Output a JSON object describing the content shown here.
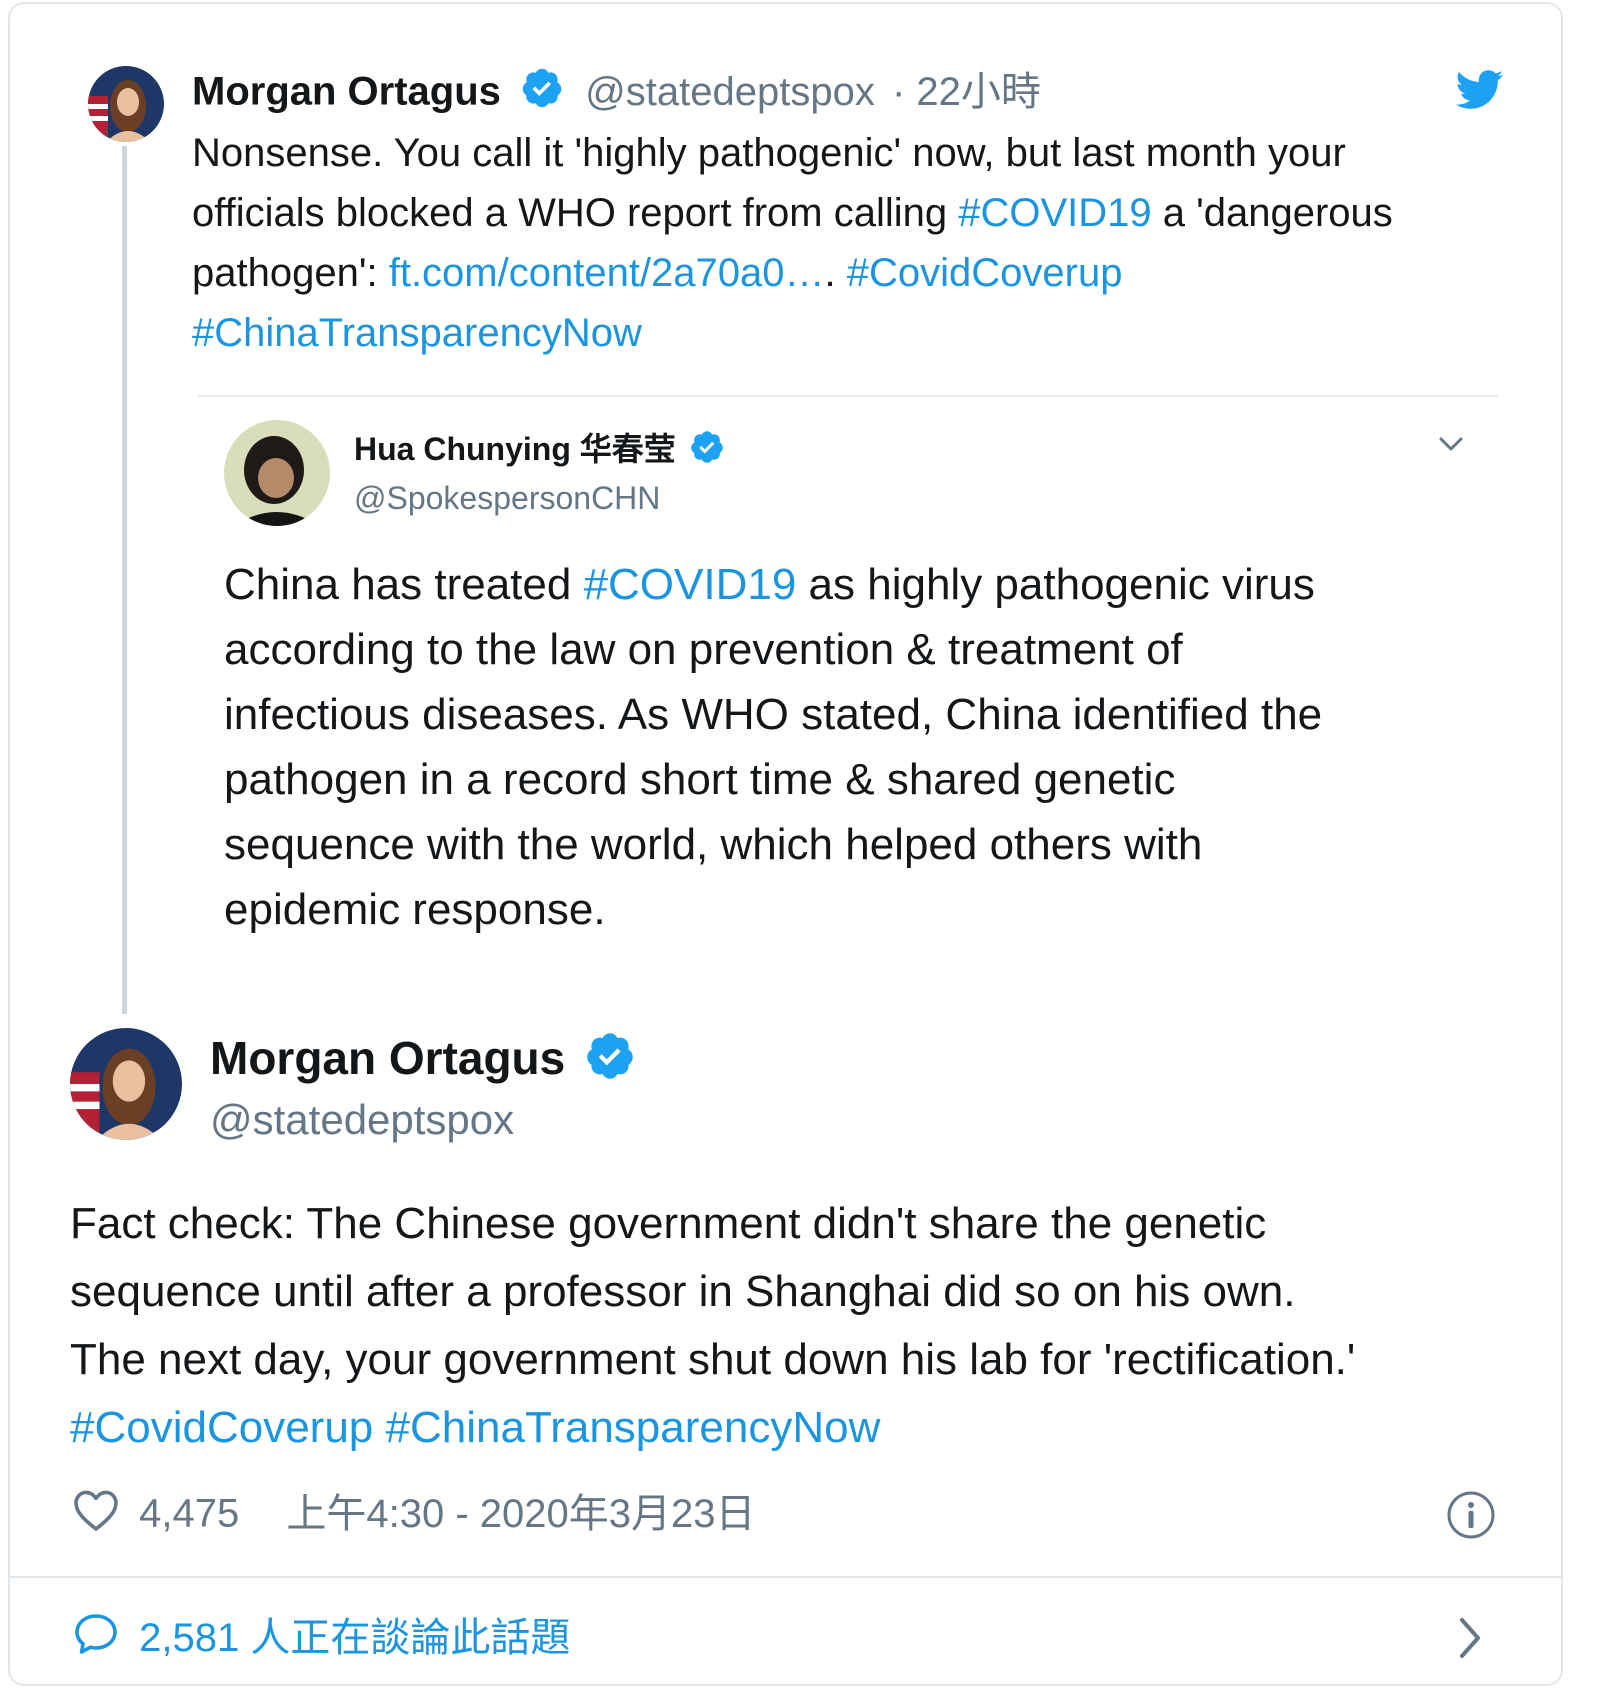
{
  "reply_tweet": {
    "name": "Morgan Ortagus",
    "handle": "@statedeptspox",
    "time": "· 22小時",
    "text_1": "Nonsense. You call it 'highly pathogenic' now, but last month your",
    "text_2a": "officials blocked a WHO report from calling ",
    "hashtag_covid": "#COVID19",
    "text_2b": " a 'dangerous",
    "text_3a": "pathogen': ",
    "link": "ft.com/content/2a70a0…",
    "text_3b": ". ",
    "hashtag_coverup": "#CovidCoverup",
    "hashtag_transparency": "#ChinaTransparencyNow"
  },
  "quoted_tweet": {
    "name": "Hua Chunying 华春莹",
    "handle": "@SpokespersonCHN",
    "text_1a": "China has treated ",
    "hashtag_covid": "#COVID19",
    "text_1b": " as highly pathogenic virus",
    "text_2": "according to the law on prevention & treatment of",
    "text_3": "infectious diseases. As WHO stated, China identified the",
    "text_4": "pathogen in a record short time & shared genetic",
    "text_5": "sequence with the world, which helped others with",
    "text_6": "epidemic response."
  },
  "main_tweet": {
    "name": "Morgan Ortagus",
    "handle": "@statedeptspox",
    "text_1": "Fact check: The Chinese government didn't share the genetic",
    "text_2": "sequence until after a professor in Shanghai did so on his own.",
    "text_3": "The next day, your government shut down his lab for 'rectification.'",
    "hashtag_coverup": "#CovidCoverup",
    "hashtag_transparency": "#ChinaTransparencyNow",
    "likes": "4,475",
    "timestamp": "上午4:30 - 2020年3月23日"
  },
  "footer": {
    "discussion": "2,581 人正在談論此話題"
  },
  "icons": {
    "twitter": "twitter-bird-icon",
    "verified": "verified-badge-icon",
    "chevron": "chevron-down-icon",
    "heart": "heart-icon",
    "info": "info-icon",
    "comment": "comment-icon",
    "arrow": "chevron-right-icon"
  },
  "colors": {
    "link": "#1b95e0",
    "verified": "#1da1f2",
    "handle": "#657786",
    "border": "#e1e8ed"
  }
}
